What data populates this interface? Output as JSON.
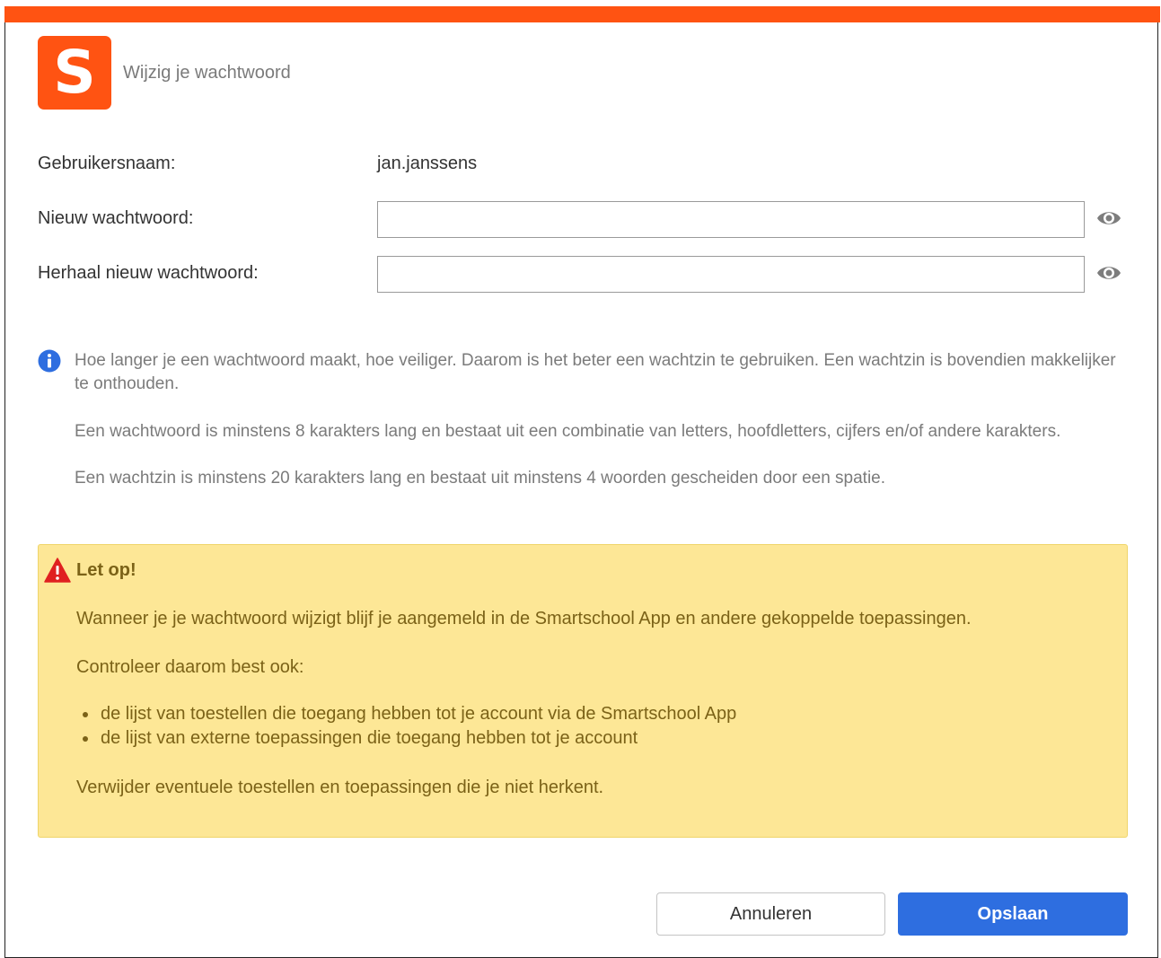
{
  "dialog": {
    "logo_letter": "S",
    "title": "Wijzig je wachtwoord"
  },
  "form": {
    "username_label": "Gebruikersnaam:",
    "username_value": "jan.janssens",
    "new_password_label": "Nieuw wachtwoord:",
    "new_password_value": "",
    "repeat_password_label": "Herhaal nieuw wachtwoord:",
    "repeat_password_value": ""
  },
  "info": {
    "paragraph1": "Hoe langer je een wachtwoord maakt, hoe veiliger. Daarom is het beter een wachtzin te gebruiken. Een wachtzin is bovendien makkelijker te onthouden.",
    "paragraph2": "Een wachtwoord is minstens 8 karakters lang en bestaat uit een combinatie van letters, hoofdletters, cijfers en/of andere karakters.",
    "paragraph3": "Een wachtzin is minstens 20 karakters lang en bestaat uit minstens 4 woorden gescheiden door een spatie."
  },
  "warning": {
    "title": "Let op!",
    "line1": "Wanneer je je wachtwoord wijzigt blijf je aangemeld in de Smartschool App en andere gekoppelde toepassingen.",
    "line2": "Controleer daarom best ook:",
    "items": [
      "de lijst van toestellen die toegang hebben tot je account via de Smartschool App",
      "de lijst van externe toepassingen die toegang hebben tot je account"
    ],
    "line3": "Verwijder eventuele toestellen en toepassingen die je niet herkent."
  },
  "buttons": {
    "cancel_label": "Annuleren",
    "save_label": "Opslaan"
  },
  "colors": {
    "brand": "#ff5312",
    "primary": "#2e6ee0",
    "warning_bg": "#fde796",
    "warning_text": "#7b6217",
    "info_icon": "#2e6ee0",
    "warning_icon": "#e02020"
  },
  "icons": {
    "show_password": "eye-icon",
    "info": "info-icon",
    "warning": "warning-triangle-icon"
  }
}
